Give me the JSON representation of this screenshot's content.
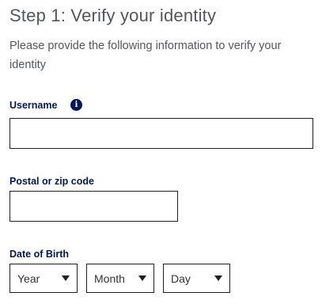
{
  "step": {
    "title": "Step 1: Verify your identity",
    "intro": "Please provide the following information to verify your identity"
  },
  "form": {
    "username": {
      "label": "Username",
      "value": "",
      "info_icon": "info-icon"
    },
    "postal": {
      "label": "Postal or zip code",
      "value": ""
    },
    "dob": {
      "label": "Date of Birth",
      "year": "Year",
      "month": "Month",
      "day": "Day",
      "caret_icon": "caret-down-icon"
    }
  },
  "colors": {
    "label_navy": "#00175a",
    "body_gray": "#53565a",
    "border": "#1d1f22"
  }
}
